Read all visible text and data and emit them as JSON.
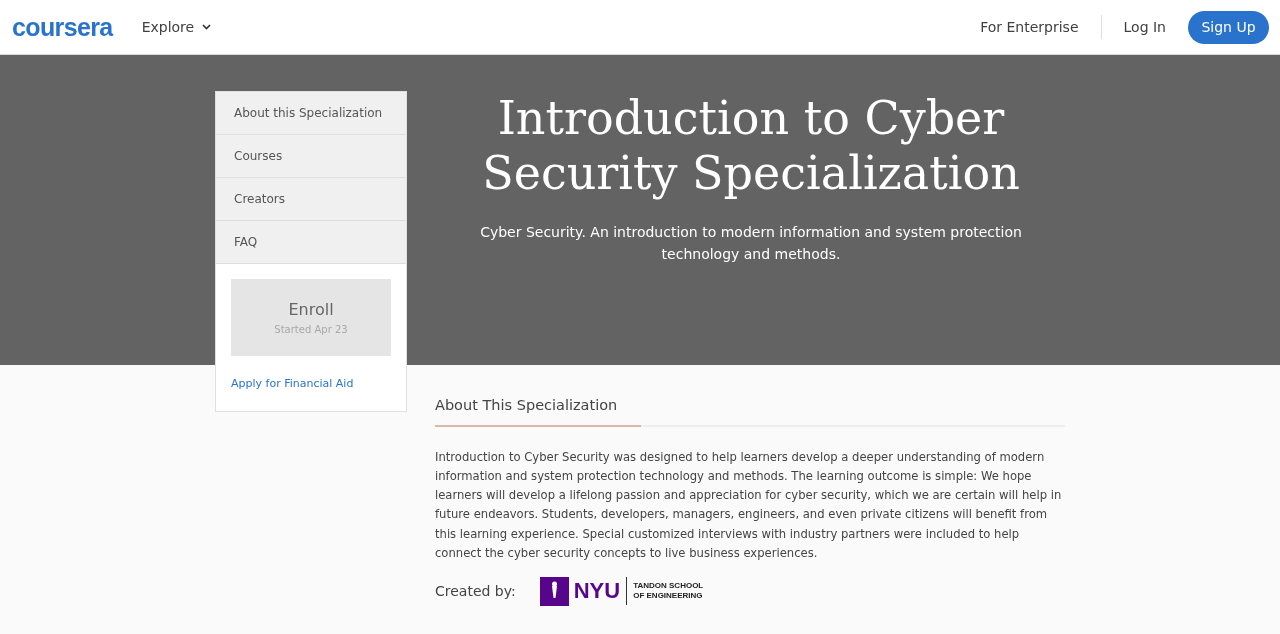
{
  "header": {
    "logo": "coursera",
    "explore": "Explore",
    "links": [
      "For Enterprise",
      "Log In"
    ],
    "signup": "Sign Up"
  },
  "sidebar": {
    "items": [
      {
        "label": "About this Specialization"
      },
      {
        "label": "Courses"
      },
      {
        "label": "Creators"
      },
      {
        "label": "FAQ"
      }
    ],
    "enroll": {
      "label": "Enroll",
      "sublabel": "Started Apr 23",
      "disabled": true
    },
    "financial_aid": "Apply for Financial Aid"
  },
  "hero": {
    "title": "Introduction to Cyber Security Specialization",
    "subtitle": "Cyber Security. An introduction to modern information and system protection technology and methods."
  },
  "about": {
    "heading": "About This Specialization",
    "text": "Introduction to Cyber Security was designed to help learners develop a deeper understanding of modern information and system protection technology and methods. The learning outcome is simple: We hope learners will develop a lifelong passion and appreciation for cyber security, which we are certain will help in future endeavors. Students, developers, managers, engineers, and even private citizens will benefit from this learning experience. Special customized interviews with industry partners were included to help connect the cyber security concepts to live business experiences.",
    "created_by": "Created by:",
    "creator_logo": {
      "wordmark": "NYU",
      "line1": "TANDON SCHOOL",
      "line2": "OF ENGINEERING"
    }
  }
}
